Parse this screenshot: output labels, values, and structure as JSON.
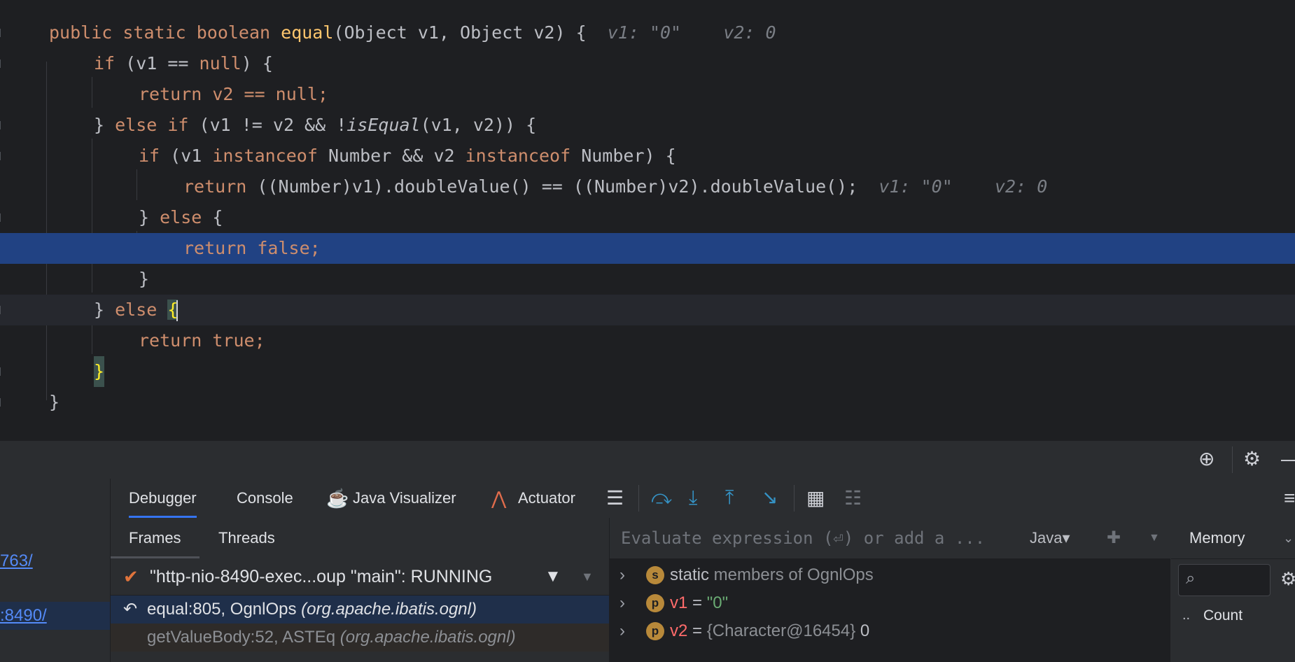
{
  "editor": {
    "lines": [
      {
        "kind": "signature",
        "kw": "public static boolean ",
        "name": "equal",
        "params": "(Object v1, Object v2) {",
        "hint1": "v1: \"0\"",
        "hint2": "v2: 0"
      },
      {
        "kind": "if",
        "kw": "if ",
        "rest": "(v1 == ",
        "kw2": "null",
        ") {": "",
        "tail": ") {"
      },
      {
        "kind": "return",
        "text": "return v2 == null;"
      },
      {
        "kind": "elseif",
        "text_a": "} ",
        "kw": "else if ",
        "text_b": "(v1 != v2 && !",
        "fn": "isEqual",
        "text_c": "(v1, v2)) {"
      },
      {
        "kind": "inst",
        "kw": "if ",
        "t1": "(v1 ",
        "kw2": "instanceof ",
        "t2": "Number && v2 ",
        "kw3": "instanceof ",
        "t3": "Number) {"
      },
      {
        "kind": "ret2",
        "kw": "return ",
        "text": "((Number)v1).doubleValue() == ((Number)v2).doubleValue();",
        "hint1": "v1: \"0\"",
        "hint2": "v2: 0"
      },
      {
        "kind": "else1",
        "t1": "} ",
        "kw": "else ",
        "t2": "{"
      },
      {
        "kind": "retfalse",
        "kw": "return ",
        "val": "false;"
      },
      {
        "kind": "close",
        "text": "}"
      },
      {
        "kind": "else2",
        "t1": "} ",
        "kw": "else ",
        "brace": "{"
      },
      {
        "kind": "rettrue",
        "kw": "return ",
        "val": "true;"
      },
      {
        "kind": "brace",
        "text": "}"
      },
      {
        "kind": "close",
        "text": "}"
      }
    ]
  },
  "toolbar": {
    "tabs": [
      "Debugger",
      "Console",
      "Java Visualizer",
      "Actuator"
    ]
  },
  "left": {
    "links": [
      "763/",
      ":8490/"
    ]
  },
  "frames": {
    "tabs": [
      "Frames",
      "Threads"
    ],
    "thread": "\"http-nio-8490-exec...oup \"main\": RUNNING",
    "rows": [
      {
        "method": "equal:805, OgnlOps ",
        "pkg": "(org.apache.ibatis.ognl)"
      },
      {
        "method": "getValueBody:52, ASTEq ",
        "pkg": "(org.apache.ibatis.ognl)"
      }
    ]
  },
  "variables": {
    "eval_placeholder": "Evaluate expression (⏎) or add a ...",
    "lang": "Java",
    "rows": [
      {
        "badge": "s",
        "name": "static",
        "rest": " members of OgnlOps"
      },
      {
        "badge": "p",
        "name": "v1",
        "eq": " = ",
        "value": "\"0\""
      },
      {
        "badge": "p",
        "name": "v2",
        "eq": " = ",
        "value": "{Character@16454}",
        "extra": " 0"
      }
    ]
  },
  "memory": {
    "title": "Memory",
    "count_label": "Count",
    "dots": ".."
  }
}
